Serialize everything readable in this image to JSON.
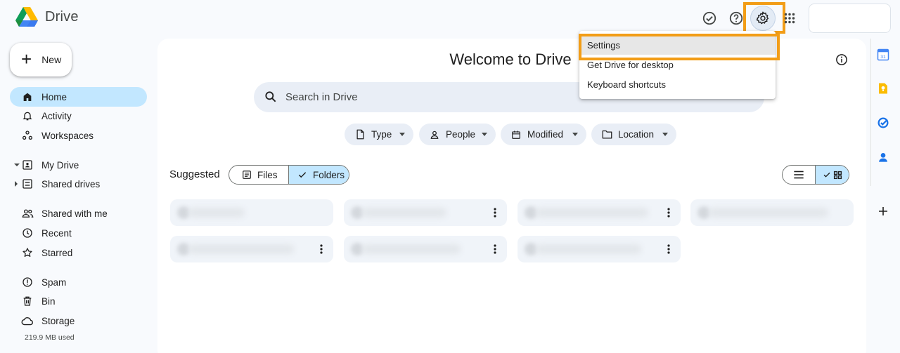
{
  "app": {
    "name": "Drive"
  },
  "nav": {
    "new_label": "New",
    "items": [
      {
        "label": "Home"
      },
      {
        "label": "Activity"
      },
      {
        "label": "Workspaces"
      },
      {
        "label": "My Drive"
      },
      {
        "label": "Shared drives"
      },
      {
        "label": "Shared with me"
      },
      {
        "label": "Recent"
      },
      {
        "label": "Starred"
      },
      {
        "label": "Spam"
      },
      {
        "label": "Bin"
      },
      {
        "label": "Storage"
      }
    ],
    "storage_used": "219.9 MB used"
  },
  "main": {
    "title": "Welcome to Drive",
    "search_placeholder": "Search in Drive",
    "filters": [
      {
        "label": "Type",
        "icon": "file-icon"
      },
      {
        "label": "People",
        "icon": "person-icon"
      },
      {
        "label": "Modified",
        "icon": "calendar-icon"
      },
      {
        "label": "Location",
        "icon": "folder-icon"
      }
    ],
    "suggested_label": "Suggested",
    "toggle": {
      "files": "Files",
      "folders": "Folders",
      "selected": "Folders"
    },
    "view_selected": "grid"
  },
  "menu": {
    "items": [
      {
        "label": "Settings"
      },
      {
        "label": "Get Drive for desktop"
      },
      {
        "label": "Keyboard shortcuts"
      }
    ]
  },
  "colors": {
    "accent": "#c2e7ff",
    "highlight": "#f29d17",
    "background": "#f8fafd"
  }
}
